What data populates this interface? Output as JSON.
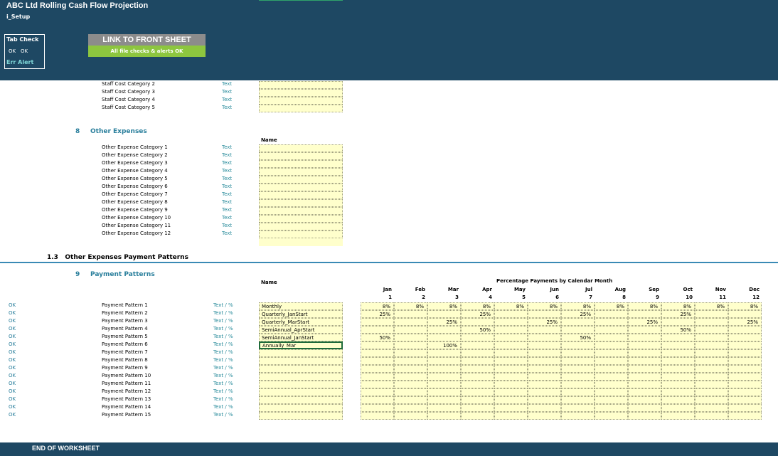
{
  "header": {
    "title": "ABC Ltd Rolling Cash Flow Projection",
    "sheet": "i_Setup",
    "tab_check": {
      "title": "Tab Check",
      "status1": "OK",
      "status2": "OK",
      "alert": "Err Alert"
    },
    "link_button": "LINK TO FRONT SHEET",
    "checks_status": "All file checks & alerts OK"
  },
  "staff_costs": {
    "rows": [
      {
        "label": "Staff Cost Category 2",
        "type": "Text"
      },
      {
        "label": "Staff Cost Category 3",
        "type": "Text"
      },
      {
        "label": "Staff Cost Category 4",
        "type": "Text"
      },
      {
        "label": "Staff Cost Category 5",
        "type": "Text"
      }
    ]
  },
  "other_expenses": {
    "number": "8",
    "title": "Other Expenses",
    "name_header": "Name",
    "rows": [
      {
        "label": "Other Expense Category 1",
        "type": "Text"
      },
      {
        "label": "Other Expense Category 2",
        "type": "Text"
      },
      {
        "label": "Other Expense Category 3",
        "type": "Text"
      },
      {
        "label": "Other Expense Category 4",
        "type": "Text"
      },
      {
        "label": "Other Expense Category 5",
        "type": "Text"
      },
      {
        "label": "Other Expense Category 6",
        "type": "Text"
      },
      {
        "label": "Other Expense Category 7",
        "type": "Text"
      },
      {
        "label": "Other Expense Category 8",
        "type": "Text"
      },
      {
        "label": "Other Expense Category 9",
        "type": "Text"
      },
      {
        "label": "Other Expense Category 10",
        "type": "Text"
      },
      {
        "label": "Other Expense Category 11",
        "type": "Text"
      },
      {
        "label": "Other Expense Category 12",
        "type": "Text"
      }
    ]
  },
  "subsection": {
    "number": "1.3",
    "title": "Other Expenses Payment Patterns"
  },
  "payment_patterns": {
    "number": "9",
    "title": "Payment Patterns",
    "name_header": "Name",
    "table_title": "Percentage Payments by Calendar Month",
    "months": [
      "Jan",
      "Feb",
      "Mar",
      "Apr",
      "May",
      "Jun",
      "Jul",
      "Aug",
      "Sep",
      "Oct",
      "Nov",
      "Dec"
    ],
    "month_numbers": [
      "1",
      "2",
      "3",
      "4",
      "5",
      "6",
      "7",
      "8",
      "9",
      "10",
      "11",
      "12"
    ],
    "rows": [
      {
        "status": "OK",
        "label": "Payment Pattern 1",
        "type": "Text / %",
        "name": "Monthly",
        "values": [
          "8%",
          "8%",
          "8%",
          "8%",
          "8%",
          "8%",
          "8%",
          "8%",
          "8%",
          "8%",
          "8%",
          "8%"
        ]
      },
      {
        "status": "OK",
        "label": "Payment Pattern 2",
        "type": "Text / %",
        "name": "Quarterly_JanStart",
        "values": [
          "25%",
          "",
          "",
          "25%",
          "",
          "",
          "25%",
          "",
          "",
          "25%",
          "",
          ""
        ]
      },
      {
        "status": "OK",
        "label": "Payment Pattern 3",
        "type": "Text / %",
        "name": "Quarterly_MarStart",
        "values": [
          "",
          "",
          "25%",
          "",
          "",
          "25%",
          "",
          "",
          "25%",
          "",
          "",
          "25%"
        ]
      },
      {
        "status": "OK",
        "label": "Payment Pattern 4",
        "type": "Text / %",
        "name": "SemiAnnual_AprStart",
        "values": [
          "",
          "",
          "",
          "50%",
          "",
          "",
          "",
          "",
          "",
          "50%",
          "",
          ""
        ]
      },
      {
        "status": "OK",
        "label": "Payment Pattern 5",
        "type": "Text / %",
        "name": "SemiAnnual_JanStart",
        "values": [
          "50%",
          "",
          "",
          "",
          "",
          "",
          "50%",
          "",
          "",
          "",
          "",
          ""
        ]
      },
      {
        "status": "OK",
        "label": "Payment Pattern 6",
        "type": "Text / %",
        "name": "Annually_Mar",
        "values": [
          "",
          "",
          "100%",
          "",
          "",
          "",
          "",
          "",
          "",
          "",
          "",
          ""
        ]
      },
      {
        "status": "OK",
        "label": "Payment Pattern 7",
        "type": "Text / %",
        "name": "",
        "values": [
          "",
          "",
          "",
          "",
          "",
          "",
          "",
          "",
          "",
          "",
          "",
          ""
        ]
      },
      {
        "status": "OK",
        "label": "Payment Pattern 8",
        "type": "Text / %",
        "name": "",
        "values": [
          "",
          "",
          "",
          "",
          "",
          "",
          "",
          "",
          "",
          "",
          "",
          ""
        ]
      },
      {
        "status": "OK",
        "label": "Payment Pattern 9",
        "type": "Text / %",
        "name": "",
        "values": [
          "",
          "",
          "",
          "",
          "",
          "",
          "",
          "",
          "",
          "",
          "",
          ""
        ]
      },
      {
        "status": "OK",
        "label": "Payment Pattern 10",
        "type": "Text / %",
        "name": "",
        "values": [
          "",
          "",
          "",
          "",
          "",
          "",
          "",
          "",
          "",
          "",
          "",
          ""
        ]
      },
      {
        "status": "OK",
        "label": "Payment Pattern 11",
        "type": "Text / %",
        "name": "",
        "values": [
          "",
          "",
          "",
          "",
          "",
          "",
          "",
          "",
          "",
          "",
          "",
          ""
        ]
      },
      {
        "status": "OK",
        "label": "Payment Pattern 12",
        "type": "Text / %",
        "name": "",
        "values": [
          "",
          "",
          "",
          "",
          "",
          "",
          "",
          "",
          "",
          "",
          "",
          ""
        ]
      },
      {
        "status": "OK",
        "label": "Payment Pattern 13",
        "type": "Text / %",
        "name": "",
        "values": [
          "",
          "",
          "",
          "",
          "",
          "",
          "",
          "",
          "",
          "",
          "",
          ""
        ]
      },
      {
        "status": "OK",
        "label": "Payment Pattern 14",
        "type": "Text / %",
        "name": "",
        "values": [
          "",
          "",
          "",
          "",
          "",
          "",
          "",
          "",
          "",
          "",
          "",
          ""
        ]
      },
      {
        "status": "OK",
        "label": "Payment Pattern 15",
        "type": "Text / %",
        "name": "",
        "values": [
          "",
          "",
          "",
          "",
          "",
          "",
          "",
          "",
          "",
          "",
          "",
          ""
        ]
      }
    ]
  },
  "footer": {
    "text": "END OF WORKSHEET"
  }
}
